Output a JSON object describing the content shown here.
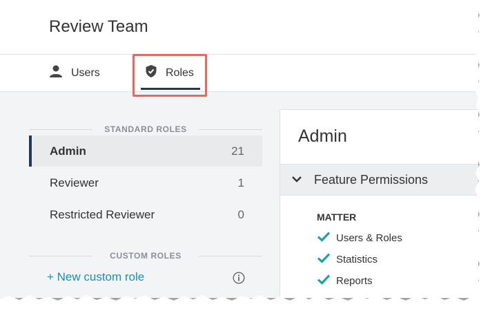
{
  "header": {
    "title": "Review Team"
  },
  "tabs": [
    {
      "label": "Users",
      "icon": "user-icon"
    },
    {
      "label": "Roles",
      "icon": "shield-check-icon"
    }
  ],
  "standard_roles": {
    "label": "STANDARD ROLES",
    "items": [
      {
        "name": "Admin",
        "count": "21",
        "active": true
      },
      {
        "name": "Reviewer",
        "count": "1",
        "active": false
      },
      {
        "name": "Restricted Reviewer",
        "count": "0",
        "active": false
      }
    ]
  },
  "custom_roles": {
    "label": "CUSTOM ROLES",
    "new_label": "+ New custom role",
    "info_icon": "info-icon"
  },
  "detail": {
    "title": "Admin",
    "feature_permissions": "Feature Permissions",
    "group": "MATTER",
    "permissions": [
      "Users & Roles",
      "Statistics",
      "Reports"
    ]
  },
  "colors": {
    "accent": "#1f3a52",
    "link": "#1a8fb8",
    "check": "#1aa3a3",
    "highlight": "#e8695b"
  }
}
